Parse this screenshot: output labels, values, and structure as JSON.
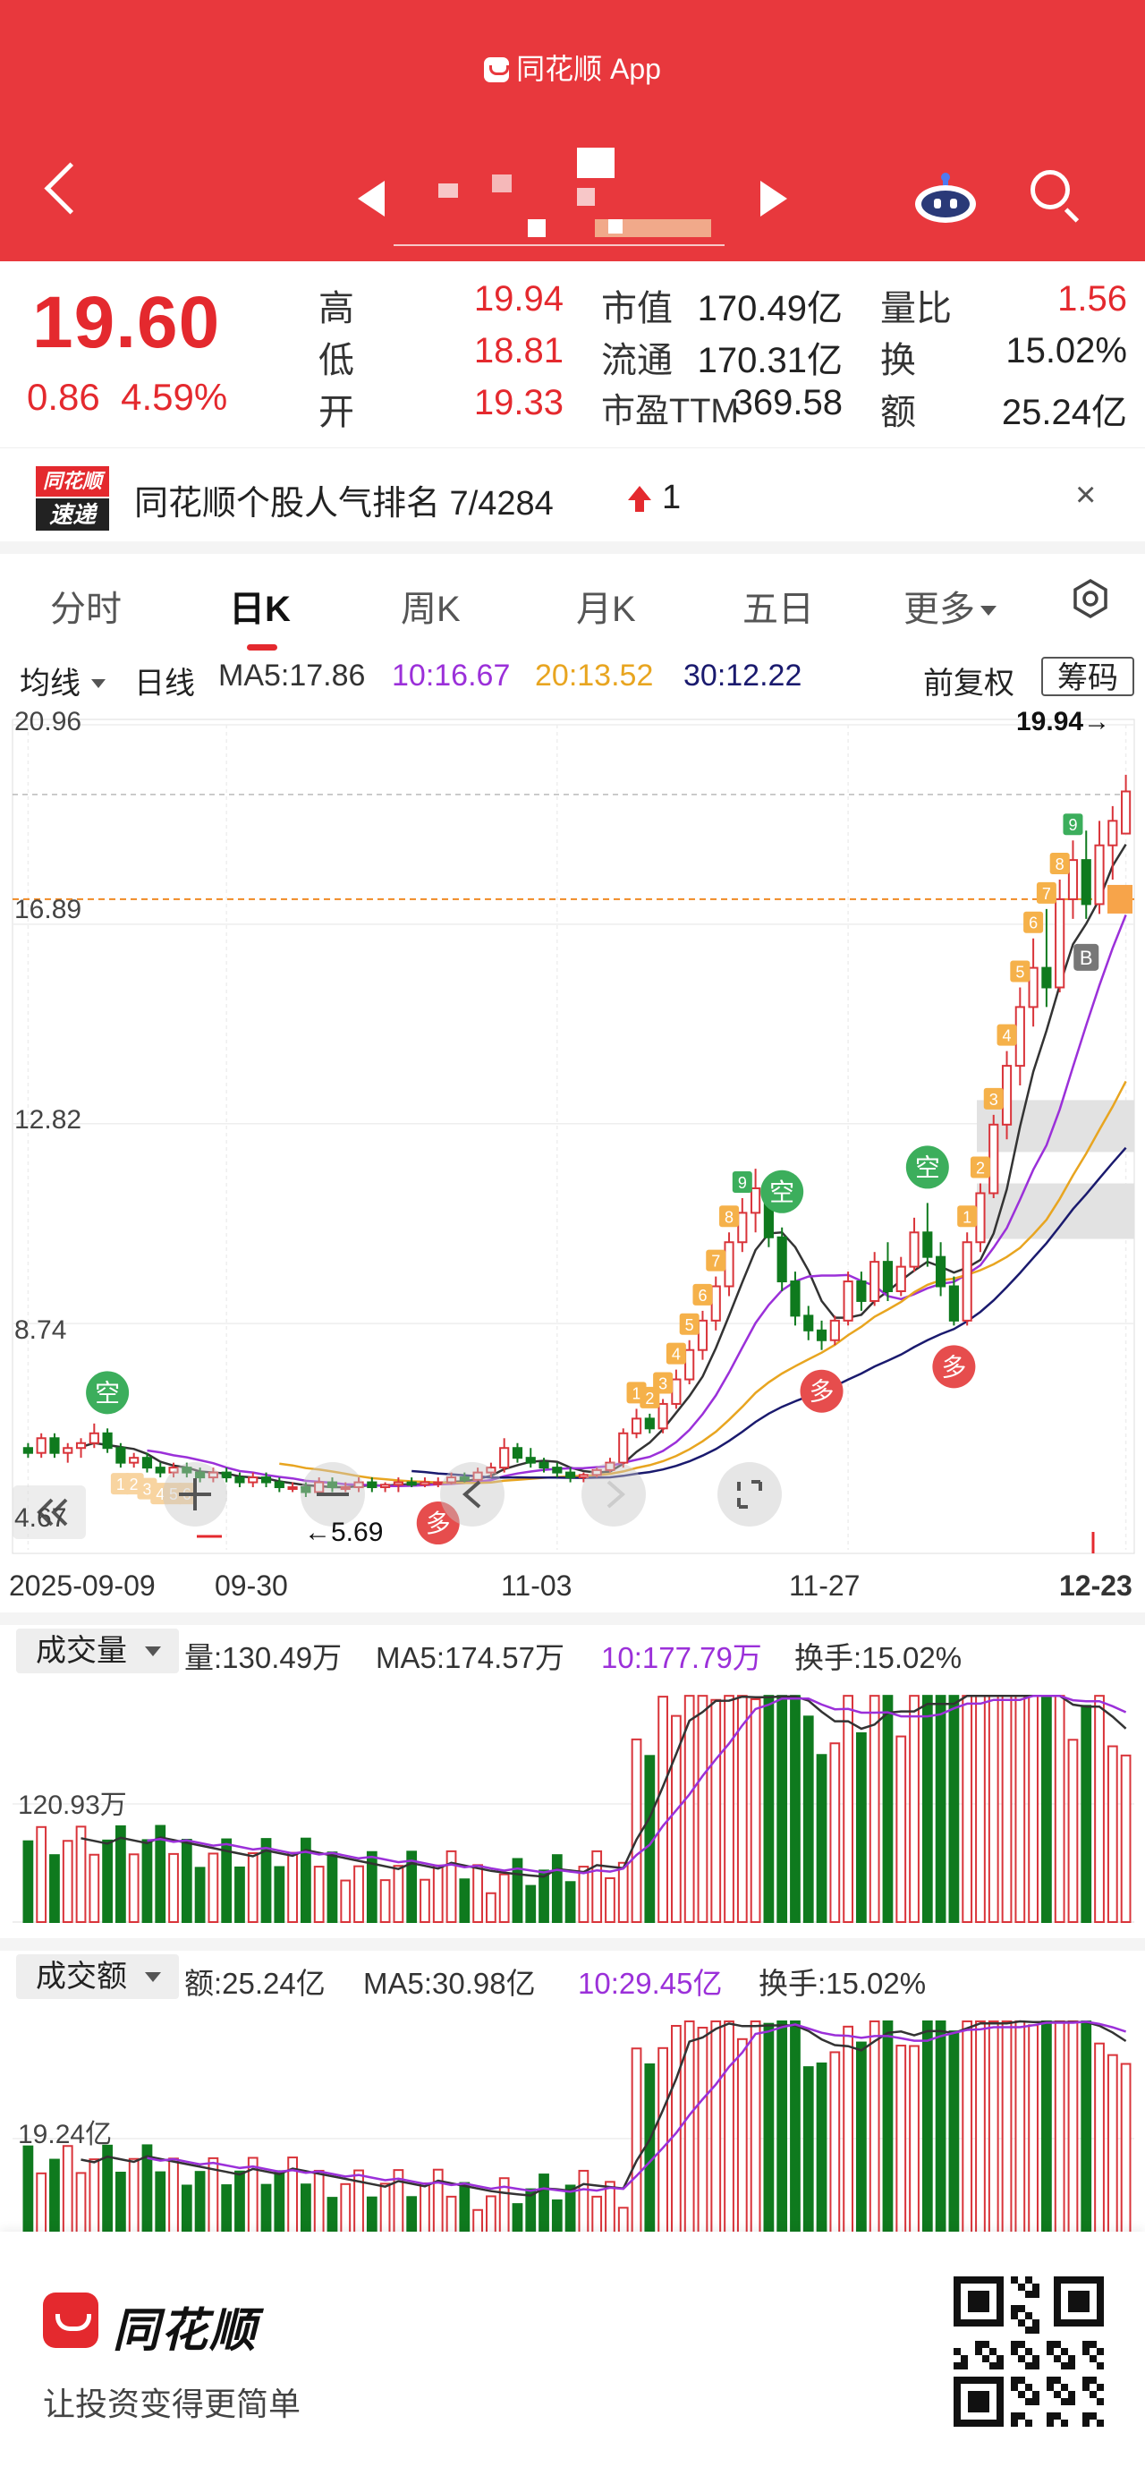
{
  "header": {
    "app_title": "同花顺 App",
    "bg_color": "#e8383d"
  },
  "quote": {
    "price": "19.60",
    "change": "0.86",
    "change_pct": "4.59%",
    "rows": [
      {
        "l1": "高",
        "v1": "19.94",
        "l2": "市值",
        "v2": "170.49亿",
        "l3": "量比",
        "v3": "1.56"
      },
      {
        "l1": "低",
        "v1": "18.81",
        "l2": "流通",
        "v2": "170.31亿",
        "l3": "换",
        "v3": "15.02%"
      },
      {
        "l1": "开",
        "v1": "19.33",
        "l2": "市盈TTM",
        "v2": "369.58",
        "l3": "额",
        "v3": "25.24亿"
      }
    ]
  },
  "banner": {
    "logo_top": "同花顺",
    "logo_bottom": "速递",
    "text": "同花顺个股人气排名 7/4284",
    "count": "1",
    "close": "×"
  },
  "tabs": [
    "分时",
    "日K",
    "周K",
    "月K",
    "五日",
    "更多"
  ],
  "ma_bar": {
    "select_label": "均线",
    "line_label": "日线",
    "ma5": "MA5:17.86",
    "ma10": "10:16.67",
    "ma20": "20:13.52",
    "ma30": "30:12.22",
    "adjust": "前复权",
    "chip": "筹码",
    "colors": {
      "ma5": "#333333",
      "ma10": "#9b30d9",
      "ma20": "#e8a520",
      "ma30": "#1a1a6e"
    }
  },
  "kchart": {
    "y_labels": [
      "20.96",
      "16.89",
      "12.82",
      "8.74",
      "4.67"
    ],
    "high_label": "19.94→",
    "low_label": "←5.69",
    "x_labels": [
      "2025-09-09",
      "09-30",
      "11-03",
      "11-27",
      "12-23"
    ],
    "signals": [
      {
        "text": "空",
        "color": "#3cae5c"
      },
      {
        "text": "多",
        "color": "#e64d4d"
      },
      {
        "text": "9",
        "color": "#3cae5c"
      },
      {
        "text": "B",
        "color": "#777777"
      }
    ]
  },
  "volume": {
    "select_label": "成交量",
    "vol": "量:130.49万",
    "ma5": "MA5:174.57万",
    "ma10": "10:177.79万",
    "turnover": "换手:15.02%",
    "axis_label": "120.93万"
  },
  "amount": {
    "select_label": "成交额",
    "amt": "额:25.24亿",
    "ma5": "MA5:30.98亿",
    "ma10": "10:29.45亿",
    "turnover": "换手:15.02%",
    "axis_label": "19.24亿"
  },
  "footer": {
    "brand": "同花顺",
    "slogan": "让投资变得更简单"
  },
  "chart_data": {
    "type": "candlestick",
    "title": "",
    "x_ticks": [
      "2025-09-09",
      "09-30",
      "11-03",
      "11-27",
      "12-23"
    ],
    "ylim": [
      4.67,
      20.96
    ],
    "y_ticks": [
      20.96,
      16.89,
      12.82,
      8.74,
      4.67
    ],
    "candles": [
      [
        6.2,
        6.3,
        6.0,
        6.1
      ],
      [
        6.1,
        6.5,
        6.0,
        6.4
      ],
      [
        6.4,
        6.5,
        6.0,
        6.1
      ],
      [
        6.1,
        6.3,
        5.9,
        6.2
      ],
      [
        6.2,
        6.4,
        6.0,
        6.3
      ],
      [
        6.3,
        6.7,
        6.2,
        6.5
      ],
      [
        6.5,
        6.6,
        6.1,
        6.2
      ],
      [
        6.2,
        6.3,
        5.8,
        5.9
      ],
      [
        5.9,
        6.1,
        5.8,
        6.0
      ],
      [
        6.0,
        6.1,
        5.7,
        5.8
      ],
      [
        5.8,
        5.9,
        5.6,
        5.7
      ],
      [
        5.7,
        5.9,
        5.6,
        5.8
      ],
      [
        5.8,
        5.9,
        5.6,
        5.7
      ],
      [
        5.7,
        5.8,
        5.5,
        5.6
      ],
      [
        5.6,
        5.8,
        5.5,
        5.7
      ],
      [
        5.7,
        5.8,
        5.5,
        5.6
      ],
      [
        5.6,
        5.7,
        5.4,
        5.5
      ],
      [
        5.5,
        5.7,
        5.4,
        5.6
      ],
      [
        5.6,
        5.7,
        5.4,
        5.5
      ],
      [
        5.5,
        5.6,
        5.3,
        5.4
      ],
      [
        5.4,
        5.5,
        5.3,
        5.4
      ],
      [
        5.4,
        5.5,
        5.2,
        5.3
      ],
      [
        5.3,
        5.6,
        5.3,
        5.5
      ],
      [
        5.5,
        5.6,
        5.3,
        5.4
      ],
      [
        5.4,
        5.5,
        5.3,
        5.4
      ],
      [
        5.4,
        5.6,
        5.3,
        5.5
      ],
      [
        5.5,
        5.6,
        5.3,
        5.4
      ],
      [
        5.4,
        5.5,
        5.3,
        5.45
      ],
      [
        5.45,
        5.6,
        5.3,
        5.5
      ],
      [
        5.5,
        5.6,
        5.4,
        5.45
      ],
      [
        5.45,
        5.6,
        5.4,
        5.5
      ],
      [
        5.5,
        5.6,
        5.4,
        5.5
      ],
      [
        5.5,
        5.7,
        5.45,
        5.6
      ],
      [
        5.6,
        5.7,
        5.5,
        5.55
      ],
      [
        5.55,
        5.8,
        5.5,
        5.7
      ],
      [
        5.7,
        5.9,
        5.6,
        5.8
      ],
      [
        5.8,
        6.4,
        5.7,
        6.2
      ],
      [
        6.2,
        6.3,
        5.9,
        6.0
      ],
      [
        6.0,
        6.2,
        5.8,
        5.9
      ],
      [
        5.9,
        6.0,
        5.7,
        5.8
      ],
      [
        5.8,
        5.9,
        5.6,
        5.7
      ],
      [
        5.7,
        5.8,
        5.5,
        5.6
      ],
      [
        5.6,
        5.7,
        5.5,
        5.65
      ],
      [
        5.65,
        5.8,
        5.6,
        5.75
      ],
      [
        5.75,
        6.0,
        5.7,
        5.9
      ],
      [
        5.9,
        6.6,
        5.8,
        6.5
      ],
      [
        6.5,
        7.0,
        6.4,
        6.8
      ],
      [
        6.8,
        6.9,
        6.5,
        6.6
      ],
      [
        6.6,
        7.2,
        6.5,
        7.1
      ],
      [
        7.1,
        7.8,
        7.0,
        7.6
      ],
      [
        7.6,
        8.4,
        7.5,
        8.2
      ],
      [
        8.2,
        9.0,
        8.0,
        8.8
      ],
      [
        8.8,
        9.7,
        8.6,
        9.5
      ],
      [
        9.5,
        10.6,
        9.3,
        10.4
      ],
      [
        10.4,
        11.3,
        10.2,
        11.0
      ],
      [
        11.0,
        11.9,
        10.6,
        11.5
      ],
      [
        11.5,
        11.6,
        10.3,
        10.5
      ],
      [
        10.5,
        10.7,
        9.4,
        9.6
      ],
      [
        9.6,
        9.8,
        8.7,
        8.9
      ],
      [
        8.9,
        9.1,
        8.4,
        8.6
      ],
      [
        8.6,
        8.8,
        8.2,
        8.4
      ],
      [
        8.4,
        8.9,
        8.3,
        8.8
      ],
      [
        8.8,
        9.8,
        8.7,
        9.6
      ],
      [
        9.6,
        9.8,
        9.0,
        9.2
      ],
      [
        9.2,
        10.2,
        9.1,
        10.0
      ],
      [
        10.0,
        10.4,
        9.2,
        9.4
      ],
      [
        9.4,
        10.1,
        9.3,
        9.9
      ],
      [
        9.9,
        10.9,
        9.8,
        10.6
      ],
      [
        10.6,
        11.2,
        9.9,
        10.1
      ],
      [
        10.1,
        10.4,
        9.3,
        9.5
      ],
      [
        9.5,
        9.7,
        8.7,
        8.8
      ],
      [
        8.8,
        10.6,
        8.7,
        10.4
      ],
      [
        10.4,
        11.6,
        10.2,
        11.4
      ],
      [
        11.4,
        13.0,
        11.3,
        12.8
      ],
      [
        12.8,
        14.3,
        12.5,
        14.0
      ],
      [
        14.0,
        15.6,
        13.6,
        15.2
      ],
      [
        15.2,
        16.6,
        14.8,
        16.0
      ],
      [
        16.0,
        17.2,
        15.2,
        15.6
      ],
      [
        15.6,
        17.8,
        15.5,
        17.4
      ],
      [
        17.4,
        18.6,
        17.0,
        18.2
      ],
      [
        18.2,
        18.8,
        17.0,
        17.3
      ],
      [
        17.3,
        19.0,
        17.1,
        18.5
      ],
      [
        18.5,
        19.3,
        17.8,
        19.0
      ],
      [
        18.74,
        19.94,
        18.81,
        19.6
      ]
    ],
    "ma5": "MA5:17.86",
    "ma10": "10:16.67",
    "ma20": "20:13.52",
    "ma30": "30:12.22",
    "high_mark": 19.94,
    "low_mark": 5.69
  }
}
